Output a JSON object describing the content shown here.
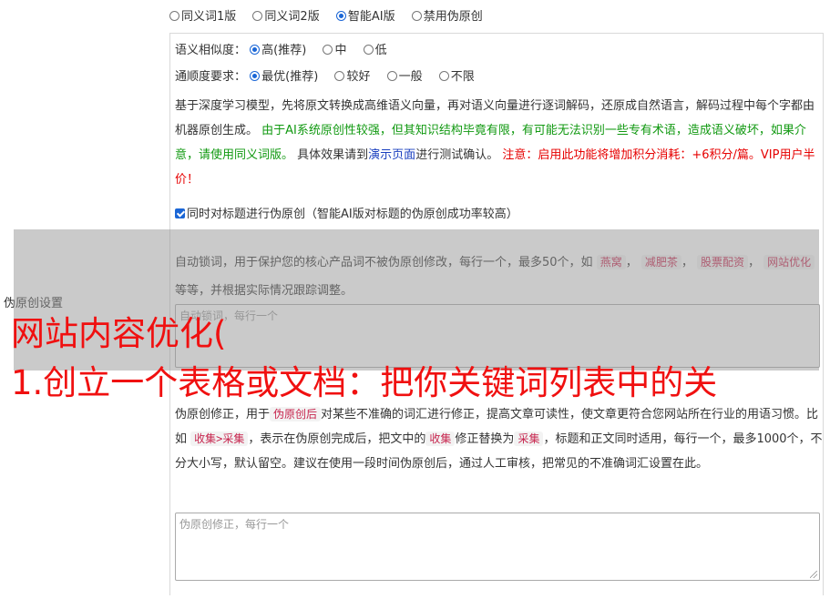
{
  "version_options": [
    {
      "label": "同义词1版",
      "selected": false
    },
    {
      "label": "同义词2版",
      "selected": false
    },
    {
      "label": "智能AI版",
      "selected": true
    },
    {
      "label": "禁用伪原创",
      "selected": false
    }
  ],
  "similarity": {
    "label": "语义相似度：",
    "options": [
      {
        "label": "高(推荐)",
        "selected": true
      },
      {
        "label": "中",
        "selected": false
      },
      {
        "label": "低",
        "selected": false
      }
    ]
  },
  "fluency": {
    "label": "通顺度要求：",
    "options": [
      {
        "label": "最优(推荐)",
        "selected": true
      },
      {
        "label": "较好",
        "selected": false
      },
      {
        "label": "一般",
        "selected": false
      },
      {
        "label": "不限",
        "selected": false
      }
    ]
  },
  "description": {
    "part1": "基于深度学习模型，先将原文转换成高维语义向量，再对语义向量进行逐词解码，还原成自然语言，解码过程中每个字都由机器原创生成。",
    "part2": "由于AI系统原创性较强，但其知识结构毕竟有限，有可能无法识别一些专有术语，造成语义破坏，如果介意，请使用同义词版。",
    "part3": "具体效果请到",
    "link": "演示页面",
    "part4": "进行测试确认。",
    "notice": "注意：启用此功能将增加积分消耗：+6积分/篇。VIP用户半价！"
  },
  "title_option": {
    "label": "同时对标题进行伪原创（智能AI版对标题的伪原创成功率较高）",
    "checked": true
  },
  "lock_words": {
    "text_before": "自动锁词，用于保护您的核心产品词不被伪原创修改，每行一个，最多50个，如",
    "examples": [
      "燕窝",
      "减肥茶",
      "股票配资",
      "网站优化"
    ],
    "text_after": "等等，并根据实际情况跟踪调整。",
    "placeholder": "自动锁词，每行一个"
  },
  "side_label": "伪原创设置",
  "headline_line1": "网站内容优化(",
  "headline_line2": "1.创立一个表格或文档：把你关键词列表中的关",
  "correction": {
    "text1": "伪原创修正，用于",
    "tag1": "伪原创后",
    "text2": "对某些不准确的词汇进行修正，提高文章可读性，使文章更符合您网站所在行业的用语习惯。比如",
    "tag2": "收集>采集",
    "text3": "，表示在伪原创完成后，把文中的",
    "tag3": "收集",
    "text4": "修正替换为",
    "tag4": "采集",
    "text5": "，标题和正文同时适用，每行一个，最多1000个，不分大小写，默认留空。建议在使用一段时间伪原创后，通过人工审核，把常见的不准确词汇设置在此。",
    "placeholder": "伪原创修正，每行一个"
  },
  "colors": {
    "accent": "#1a66d6",
    "green": "#119911",
    "red": "#e60000",
    "headline": "#f01010"
  }
}
